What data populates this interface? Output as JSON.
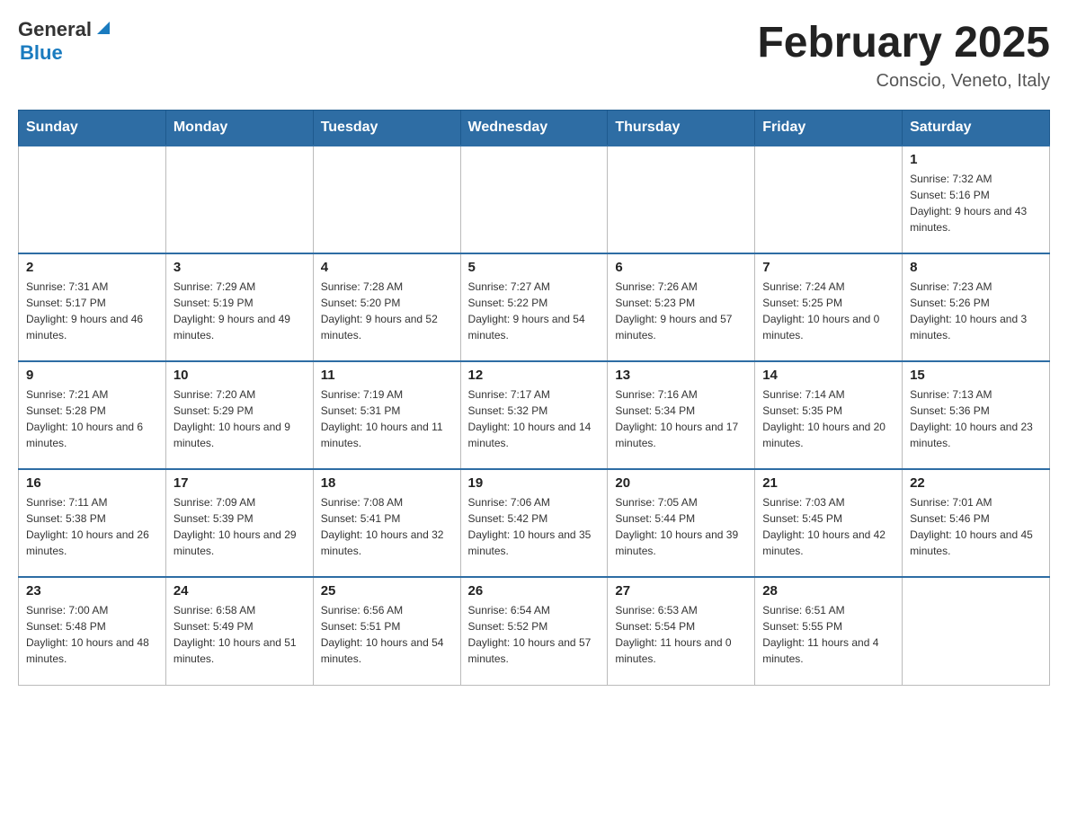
{
  "header": {
    "logo_general": "General",
    "logo_blue": "Blue",
    "month_title": "February 2025",
    "location": "Conscio, Veneto, Italy"
  },
  "days_of_week": [
    "Sunday",
    "Monday",
    "Tuesday",
    "Wednesday",
    "Thursday",
    "Friday",
    "Saturday"
  ],
  "weeks": [
    [
      {
        "day": "",
        "info": "",
        "empty": true
      },
      {
        "day": "",
        "info": "",
        "empty": true
      },
      {
        "day": "",
        "info": "",
        "empty": true
      },
      {
        "day": "",
        "info": "",
        "empty": true
      },
      {
        "day": "",
        "info": "",
        "empty": true
      },
      {
        "day": "",
        "info": "",
        "empty": true
      },
      {
        "day": "1",
        "info": "Sunrise: 7:32 AM\nSunset: 5:16 PM\nDaylight: 9 hours and 43 minutes.",
        "empty": false
      }
    ],
    [
      {
        "day": "2",
        "info": "Sunrise: 7:31 AM\nSunset: 5:17 PM\nDaylight: 9 hours and 46 minutes.",
        "empty": false
      },
      {
        "day": "3",
        "info": "Sunrise: 7:29 AM\nSunset: 5:19 PM\nDaylight: 9 hours and 49 minutes.",
        "empty": false
      },
      {
        "day": "4",
        "info": "Sunrise: 7:28 AM\nSunset: 5:20 PM\nDaylight: 9 hours and 52 minutes.",
        "empty": false
      },
      {
        "day": "5",
        "info": "Sunrise: 7:27 AM\nSunset: 5:22 PM\nDaylight: 9 hours and 54 minutes.",
        "empty": false
      },
      {
        "day": "6",
        "info": "Sunrise: 7:26 AM\nSunset: 5:23 PM\nDaylight: 9 hours and 57 minutes.",
        "empty": false
      },
      {
        "day": "7",
        "info": "Sunrise: 7:24 AM\nSunset: 5:25 PM\nDaylight: 10 hours and 0 minutes.",
        "empty": false
      },
      {
        "day": "8",
        "info": "Sunrise: 7:23 AM\nSunset: 5:26 PM\nDaylight: 10 hours and 3 minutes.",
        "empty": false
      }
    ],
    [
      {
        "day": "9",
        "info": "Sunrise: 7:21 AM\nSunset: 5:28 PM\nDaylight: 10 hours and 6 minutes.",
        "empty": false
      },
      {
        "day": "10",
        "info": "Sunrise: 7:20 AM\nSunset: 5:29 PM\nDaylight: 10 hours and 9 minutes.",
        "empty": false
      },
      {
        "day": "11",
        "info": "Sunrise: 7:19 AM\nSunset: 5:31 PM\nDaylight: 10 hours and 11 minutes.",
        "empty": false
      },
      {
        "day": "12",
        "info": "Sunrise: 7:17 AM\nSunset: 5:32 PM\nDaylight: 10 hours and 14 minutes.",
        "empty": false
      },
      {
        "day": "13",
        "info": "Sunrise: 7:16 AM\nSunset: 5:34 PM\nDaylight: 10 hours and 17 minutes.",
        "empty": false
      },
      {
        "day": "14",
        "info": "Sunrise: 7:14 AM\nSunset: 5:35 PM\nDaylight: 10 hours and 20 minutes.",
        "empty": false
      },
      {
        "day": "15",
        "info": "Sunrise: 7:13 AM\nSunset: 5:36 PM\nDaylight: 10 hours and 23 minutes.",
        "empty": false
      }
    ],
    [
      {
        "day": "16",
        "info": "Sunrise: 7:11 AM\nSunset: 5:38 PM\nDaylight: 10 hours and 26 minutes.",
        "empty": false
      },
      {
        "day": "17",
        "info": "Sunrise: 7:09 AM\nSunset: 5:39 PM\nDaylight: 10 hours and 29 minutes.",
        "empty": false
      },
      {
        "day": "18",
        "info": "Sunrise: 7:08 AM\nSunset: 5:41 PM\nDaylight: 10 hours and 32 minutes.",
        "empty": false
      },
      {
        "day": "19",
        "info": "Sunrise: 7:06 AM\nSunset: 5:42 PM\nDaylight: 10 hours and 35 minutes.",
        "empty": false
      },
      {
        "day": "20",
        "info": "Sunrise: 7:05 AM\nSunset: 5:44 PM\nDaylight: 10 hours and 39 minutes.",
        "empty": false
      },
      {
        "day": "21",
        "info": "Sunrise: 7:03 AM\nSunset: 5:45 PM\nDaylight: 10 hours and 42 minutes.",
        "empty": false
      },
      {
        "day": "22",
        "info": "Sunrise: 7:01 AM\nSunset: 5:46 PM\nDaylight: 10 hours and 45 minutes.",
        "empty": false
      }
    ],
    [
      {
        "day": "23",
        "info": "Sunrise: 7:00 AM\nSunset: 5:48 PM\nDaylight: 10 hours and 48 minutes.",
        "empty": false
      },
      {
        "day": "24",
        "info": "Sunrise: 6:58 AM\nSunset: 5:49 PM\nDaylight: 10 hours and 51 minutes.",
        "empty": false
      },
      {
        "day": "25",
        "info": "Sunrise: 6:56 AM\nSunset: 5:51 PM\nDaylight: 10 hours and 54 minutes.",
        "empty": false
      },
      {
        "day": "26",
        "info": "Sunrise: 6:54 AM\nSunset: 5:52 PM\nDaylight: 10 hours and 57 minutes.",
        "empty": false
      },
      {
        "day": "27",
        "info": "Sunrise: 6:53 AM\nSunset: 5:54 PM\nDaylight: 11 hours and 0 minutes.",
        "empty": false
      },
      {
        "day": "28",
        "info": "Sunrise: 6:51 AM\nSunset: 5:55 PM\nDaylight: 11 hours and 4 minutes.",
        "empty": false
      },
      {
        "day": "",
        "info": "",
        "empty": true
      }
    ]
  ]
}
